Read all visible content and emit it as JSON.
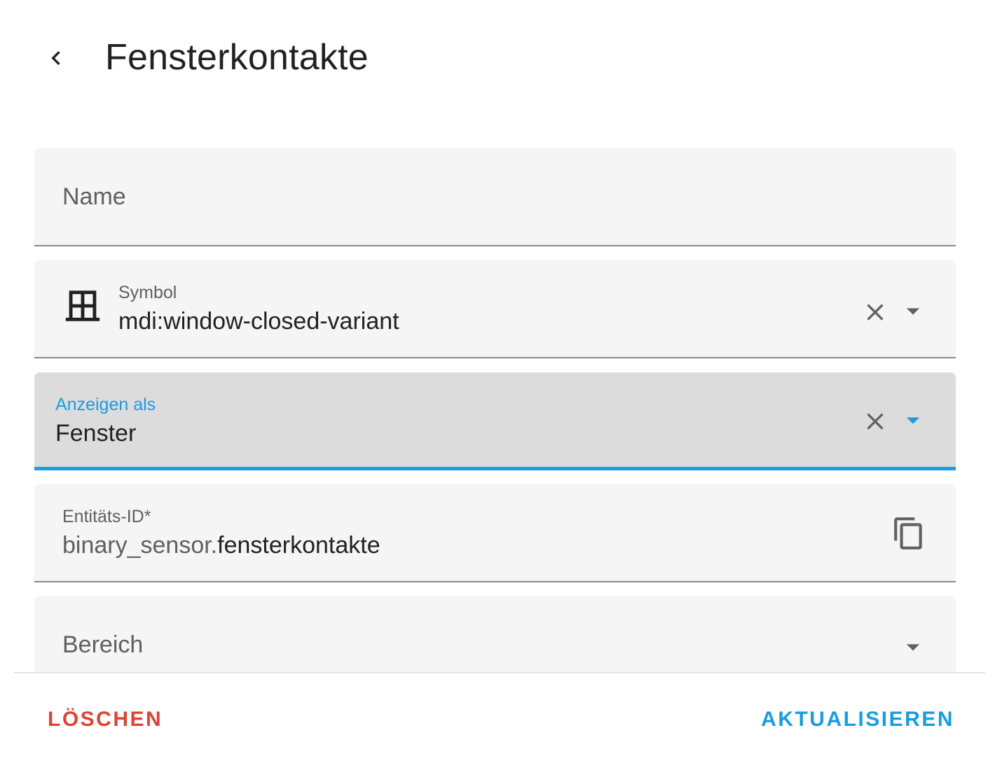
{
  "header": {
    "title": "Fensterkontakte",
    "back_icon": "chevron-left-icon"
  },
  "form": {
    "name_field": {
      "placeholder": "Name",
      "value": ""
    },
    "icon_field": {
      "label": "Symbol",
      "value": "mdi:window-closed-variant",
      "preview_icon": "window-closed-variant-icon",
      "clear_icon": "close-icon",
      "dropdown_icon": "menu-down-icon"
    },
    "device_class_field": {
      "label": "Anzeigen als",
      "value": "Fenster",
      "focused": true,
      "clear_icon": "close-icon",
      "dropdown_icon": "menu-down-icon"
    },
    "entity_id_field": {
      "label": "Entitäts-ID*",
      "prefix": "binary_sensor.",
      "value": "fensterkontakte",
      "copy_icon": "content-copy-icon"
    },
    "area_field": {
      "placeholder": "Bereich",
      "dropdown_icon": "menu-down-icon"
    }
  },
  "actions": {
    "delete_label": "LÖSCHEN",
    "update_label": "AKTUALISIEREN"
  },
  "colors": {
    "accent": "#1a9cdf",
    "danger": "#db4437",
    "field_bg": "#f5f5f5",
    "field_focused_bg": "#dcdcdc"
  }
}
